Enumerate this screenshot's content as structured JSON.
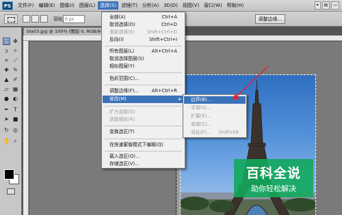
{
  "app": {
    "logo": "PS"
  },
  "menubar": {
    "items": [
      "文件(F)",
      "编辑(E)",
      "图像(I)",
      "图层(L)",
      "选择(S)",
      "滤镜(T)",
      "分析(A)",
      "3D(D)",
      "视图(V)",
      "窗口(W)",
      "帮助(H)"
    ],
    "active_index": 4
  },
  "options_bar": {
    "feather_label": "羽化:",
    "feather_value": "0 px",
    "refine_edge_label": "调整边缘..."
  },
  "document": {
    "tab_title": "bla03.jpg @ 100% (图层 0, RGB/8#)"
  },
  "select_menu": {
    "items": [
      {
        "label": "全部(A)",
        "shortcut": "Ctrl+A",
        "disabled": false
      },
      {
        "label": "取消选择(D)",
        "shortcut": "Ctrl+D",
        "disabled": false
      },
      {
        "label": "重新选择(E)",
        "shortcut": "Shift+Ctrl+D",
        "disabled": true
      },
      {
        "label": "反向(I)",
        "shortcut": "Shift+Ctrl+I",
        "disabled": false
      },
      {
        "label": "所有图层(L)",
        "shortcut": "Alt+Ctrl+A",
        "disabled": false
      },
      {
        "label": "取消选择图层(S)",
        "shortcut": "",
        "disabled": false
      },
      {
        "label": "相似图层(Y)",
        "shortcut": "",
        "disabled": false
      },
      {
        "label": "色彩范围(C)...",
        "shortcut": "",
        "disabled": false
      },
      {
        "label": "调整边缘(F)...",
        "shortcut": "Alt+Ctrl+R",
        "disabled": false
      },
      {
        "label": "修改(M)",
        "shortcut": "",
        "disabled": false,
        "highlighted": true,
        "submenu": true
      },
      {
        "label": "扩大选取(G)",
        "shortcut": "",
        "disabled": true
      },
      {
        "label": "选取相似(R)",
        "shortcut": "",
        "disabled": true
      },
      {
        "label": "变换选区(T)",
        "shortcut": "",
        "disabled": false
      },
      {
        "label": "在快速蒙版模式下编辑(Q)",
        "shortcut": "",
        "disabled": false
      },
      {
        "label": "载入选区(O)...",
        "shortcut": "",
        "disabled": false
      },
      {
        "label": "存储选区(V)...",
        "shortcut": "",
        "disabled": false
      }
    ]
  },
  "modify_submenu": {
    "items": [
      {
        "label": "边界(B)...",
        "shortcut": "",
        "highlighted": true
      },
      {
        "label": "平滑(S)...",
        "shortcut": ""
      },
      {
        "label": "扩展(E)...",
        "shortcut": ""
      },
      {
        "label": "收缩(C)...",
        "shortcut": ""
      },
      {
        "label": "羽化(F)...",
        "shortcut": "Shift+F6"
      }
    ]
  },
  "toolbox": {
    "icons": [
      "marquee-icon",
      "lasso-icon",
      "magic-wand-icon",
      "crop-icon",
      "eyedropper-icon",
      "healing-brush-icon",
      "brush-icon",
      "clone-stamp-icon",
      "history-brush-icon",
      "eraser-icon",
      "gradient-icon",
      "blur-icon",
      "dodge-icon",
      "pen-icon",
      "type-icon",
      "path-selection-icon",
      "shape-icon",
      "hand-icon",
      "zoom-icon"
    ],
    "foreground_color": "#000000",
    "background_color": "#ffffff"
  },
  "colors": {
    "menu_highlight": "#3a72b9",
    "watermark_green": "#12a85c",
    "annotation_arrow": "#e8202a"
  },
  "watermark": {
    "title": "百科全说",
    "subtitle": "助你轻松解决"
  }
}
